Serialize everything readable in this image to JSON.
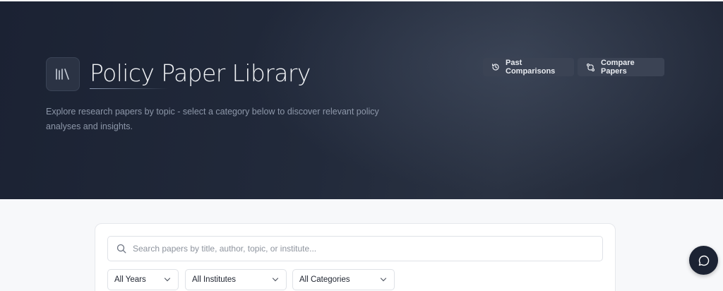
{
  "header": {
    "title": "Policy Paper Library",
    "subtitle": "Explore research papers by topic - select a category below to discover relevant policy analyses and insights.",
    "logo_icon": "library-icon",
    "buttons": [
      {
        "label": "Past Comparisons",
        "icon": "history-icon"
      },
      {
        "label": "Compare Papers",
        "icon": "compare-arrows-icon"
      }
    ]
  },
  "search": {
    "placeholder": "Search papers by title, author, topic, or institute...",
    "icon": "search-icon"
  },
  "filters": {
    "years": "All Years",
    "institutes": "All Institutes",
    "categories": "All Categories"
  },
  "chat_button": {
    "icon": "chat-icon"
  },
  "colors": {
    "hero_bg": "#1f2636",
    "button_bg": "#3b4354",
    "page_bg": "#f7f8fa"
  }
}
